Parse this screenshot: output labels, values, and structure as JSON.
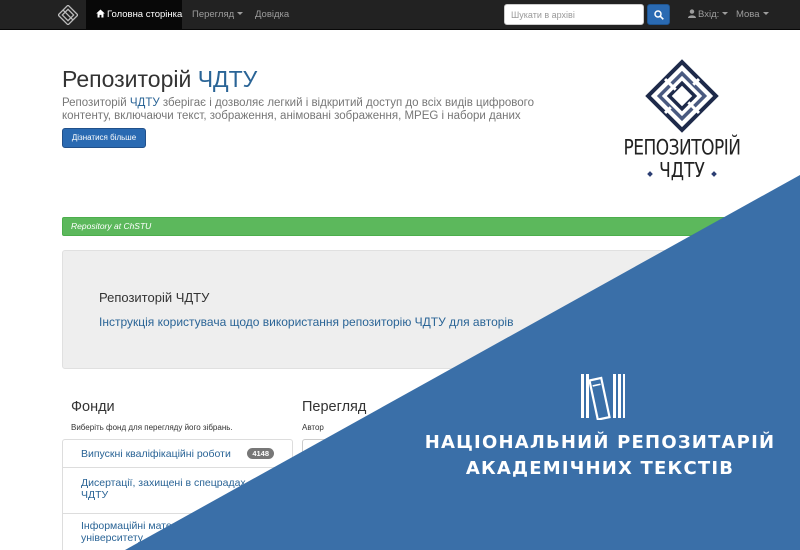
{
  "navbar": {
    "home_label": "Головна сторінка",
    "browse_label": "Перегляд",
    "help_label": "Довідка",
    "search_placeholder": "Шукати в архіві",
    "login_label": "Вхід:",
    "language_label": "Мова"
  },
  "jumbotron": {
    "title_main": "Репозиторій ",
    "title_accent": "ЧДТУ",
    "description_prefix": "Репозиторій ",
    "description_link": "ЧДТУ",
    "description_rest": " зберігає і дозволяє легкий і відкритий доступ до всіх видів цифрового контенту, включаючи текст, зображення, анімовані зображення, MPEG і набори даних",
    "learn_more_label": "Дізнатися більше"
  },
  "logo": {
    "line1": "РЕПОЗИТОРІЙ",
    "line2": "ЧДТУ"
  },
  "alert": {
    "text": "Repository at ChSTU"
  },
  "news": {
    "title": "Репозиторій ЧДТУ",
    "link": "Інструкція користувача щодо використання репозиторію ЧДТУ для авторів"
  },
  "communities": {
    "heading": "Фонди",
    "subtitle": "Виберіть фонд для перегляду його зібрань.",
    "items": [
      {
        "label": "Випускні кваліфікаційні роботи",
        "count": "4148"
      },
      {
        "label": "Дисертації, захищені в спецрадах ЧДТУ",
        "count": ""
      },
      {
        "label": "Інформаційні матеріали університету",
        "count": ""
      }
    ]
  },
  "browse": {
    "heading": "Перегляд",
    "author_label": "Автор"
  },
  "banner": {
    "line1": "НАЦІОНАЛЬНИЙ РЕПОЗИТАРІЙ",
    "line2": "АКАДЕМІЧНИХ ТЕКСТІВ"
  },
  "colors": {
    "navbar": "#222222",
    "primary": "#2a6ab2",
    "link": "#2a6496",
    "success": "#5cb85c",
    "overlay_blue": "#3a6fa8"
  },
  "icons": [
    "app-logo-icon",
    "home-icon",
    "search-icon",
    "user-icon",
    "repository-logo-icon",
    "books-icon"
  ]
}
